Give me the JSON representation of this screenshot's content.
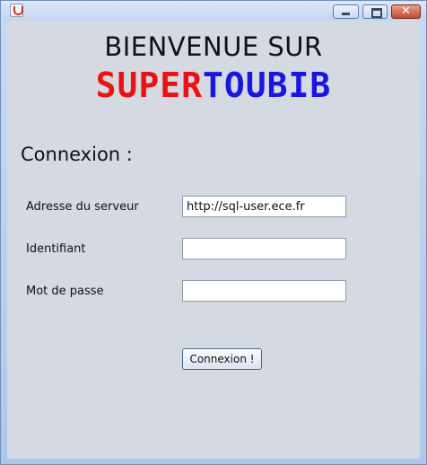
{
  "window": {
    "controls": {
      "minimize_icon": "minimize-icon",
      "maximize_icon": "maximize-icon",
      "close_label": "✕"
    }
  },
  "header": {
    "line1": "BIENVENUE SUR",
    "brand_part1": "SUPER",
    "brand_part2": "TOUBIB",
    "brand_color_1": "#ee1111",
    "brand_color_2": "#1a16e0"
  },
  "login": {
    "title": "Connexion :",
    "fields": [
      {
        "label": "Adresse du serveur",
        "value": "http://sql-user.ece.fr"
      },
      {
        "label": "Identifiant",
        "value": ""
      },
      {
        "label": "Mot de passe",
        "value": ""
      }
    ],
    "submit_label": "Connexion !"
  }
}
